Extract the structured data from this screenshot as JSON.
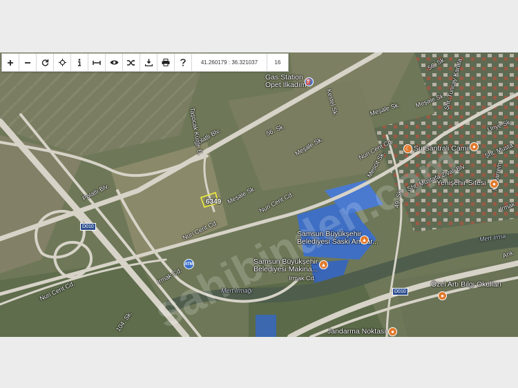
{
  "toolbar": {
    "coordinates": "41.260179 : 36.321037",
    "zoom": "16",
    "tools": [
      {
        "name": "zoom-in-button",
        "icon": "plus-icon"
      },
      {
        "name": "zoom-out-button",
        "icon": "minus-icon"
      },
      {
        "name": "refresh-button",
        "icon": "refresh-icon"
      },
      {
        "name": "locate-button",
        "icon": "crosshair-icon"
      },
      {
        "name": "info-button",
        "icon": "info-icon"
      },
      {
        "name": "measure-button",
        "icon": "measure-icon"
      },
      {
        "name": "view-button",
        "icon": "eye-icon"
      },
      {
        "name": "shuffle-button",
        "icon": "shuffle-icon"
      },
      {
        "name": "download-button",
        "icon": "download-icon"
      },
      {
        "name": "print-button",
        "icon": "print-icon"
      },
      {
        "name": "help-button",
        "icon": "help-icon"
      }
    ]
  },
  "parcel": {
    "label": "6349"
  },
  "roads": {
    "polatli_1": "Polatlı Blv.",
    "polatli_2": "Polatlı Blv.",
    "nuri_cerit_1": "Nuri Cerit Cd.",
    "nuri_cerit_2": "Nuri Cerit Cd.",
    "nuri_cerit_3": "Nuri Cerit Cd.",
    "nuri_cerit_4": "Nuri Cerit Cd.",
    "irmak_1": "Irmak Cd.",
    "irmak_2": "Irmak Cd.",
    "irmak_3": "Irmak Cd.",
    "mesale_1": "Meşale Sk.",
    "mesale_2": "Meşale Sk.",
    "mesale_3": "Meşale Sk.",
    "mesale_4": "Meşale Sk.",
    "s56": "56. Sk.",
    "s49": "49. Sk.",
    "s104": "104. Sk.",
    "s56b": "56. Sk.",
    "tasocak": "Taşocak Küme E.",
    "kestel": "Kestel Sk.",
    "sht_tuncay": "Şht. Tuncay Karata",
    "unye": "Ünye Sk.",
    "sht_mustafa": "Şht. Mustafa Zivali Blv.",
    "sht_mustafa2": "Şht. Musta",
    "muharrem": "Muharrem",
    "mescit": "Mescit Sk.",
    "mert_1": "Mert Irmağı",
    "mert_2": "Mert Irma",
    "ank": "Ank",
    "irm_r": "Irmak",
    "d010_1": "D010",
    "d010_2": "D010"
  },
  "pois": {
    "gas": {
      "line1": "Gas Station",
      "line2": "Opet İlkadım"
    },
    "su_santrali": "Su Santrali Camii",
    "yenisehir": "Yenişehir Sitesi",
    "saski": {
      "line1": "Samsun Büyükşehir",
      "line2": "Belediyesi Saski Ambar..."
    },
    "makina": {
      "line1": "Samsun Büyükşehir",
      "line2": "Belediyesi Makina..."
    },
    "ozel": "Özel Artı Bilgi Okulları",
    "jandarma": "Jandarma Noktası",
    "atm": "ATM"
  },
  "watermark": "sahibinden.com"
}
